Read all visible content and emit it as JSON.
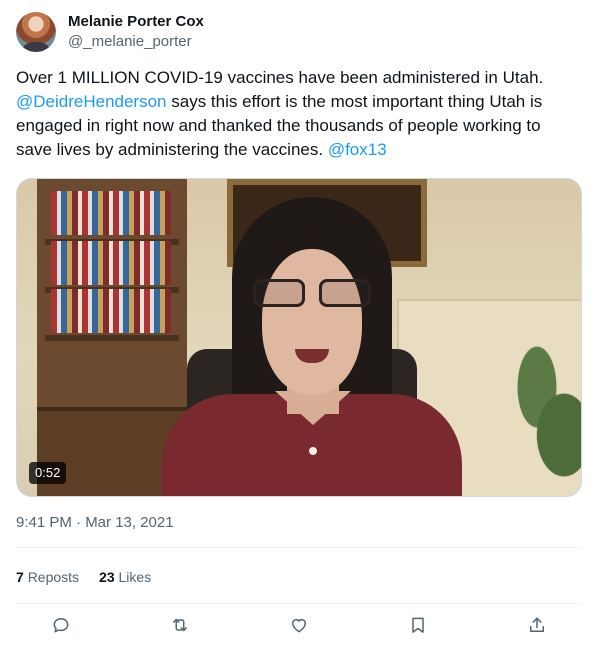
{
  "author": {
    "display_name": "Melanie Porter Cox",
    "handle": "@_melanie_porter"
  },
  "tweet": {
    "text_part1": "Over 1 MILLION COVID-19 vaccines have been administered in Utah. ",
    "mention1": "@DeidreHenderson",
    "text_part2": " says this effort is the most important thing Utah is engaged in right now and thanked the thousands of people working to save lives by administering the vaccines. ",
    "mention2": "@fox13"
  },
  "media": {
    "duration": "0:52"
  },
  "timestamp": "9:41 PM · Mar 13, 2021",
  "stats": {
    "reposts_count": "7",
    "reposts_label": "Reposts",
    "likes_count": "23",
    "likes_label": "Likes"
  },
  "colors": {
    "link": "#1d9bf0",
    "secondary_text": "#536471",
    "primary_text": "#0f1419"
  },
  "icons": [
    "reply-icon",
    "repost-icon",
    "like-icon",
    "bookmark-icon",
    "share-icon"
  ]
}
